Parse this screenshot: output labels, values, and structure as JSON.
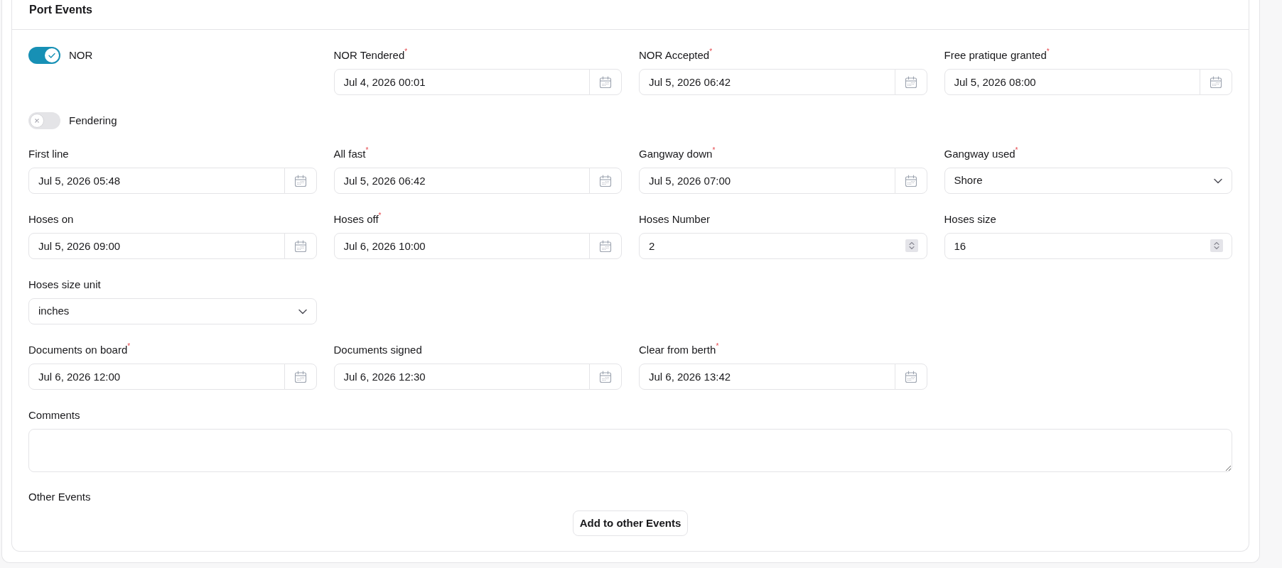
{
  "section": {
    "title": "Port Events"
  },
  "rows": [
    {
      "fields": [
        {
          "kind": "toggle",
          "label": "NOR",
          "on": true
        },
        {
          "kind": "datetime",
          "label": "NOR Tendered$^{*}$",
          "value": "Jul 4, 2026 00:01"
        },
        {
          "kind": "datetime",
          "label": "NOR Accepted$^{*}$",
          "value": "Jul 5, 2026 06:42"
        },
        {
          "kind": "datetime",
          "label": "Free pratique granted$^{*}$",
          "value": "Jul 5, 2026 08:00"
        }
      ]
    },
    {
      "fields": [
        {
          "kind": "toggle",
          "label": "Fendering",
          "on": false
        }
      ]
    },
    {
      "fields": [
        {
          "kind": "datetime",
          "label": "First line",
          "value": "Jul 5, 2026 05:48"
        },
        {
          "kind": "datetime",
          "label": "All fast$^{*}$",
          "value": "Jul 5, 2026 06:42"
        },
        {
          "kind": "datetime",
          "label": "Gangway down$^{*}$",
          "value": "Jul 5, 2026 07:00"
        },
        {
          "kind": "select",
          "label": "Gangway used$^{*}$",
          "value": "Shore"
        }
      ]
    },
    {
      "fields": [
        {
          "kind": "datetime",
          "label": "Hoses on",
          "value": "Jul 5, 2026 09:00"
        },
        {
          "kind": "datetime",
          "label": "Hoses off$^{*}$",
          "value": "Jul 6, 2026 10:00"
        },
        {
          "kind": "number",
          "label": "Hoses Number",
          "value": "2"
        },
        {
          "kind": "number",
          "label": "Hoses size",
          "value": "16"
        }
      ]
    },
    {
      "fields": [
        {
          "kind": "select",
          "label": "Hoses size unit",
          "value": "inches"
        }
      ]
    },
    {
      "fields": [
        {
          "kind": "datetime",
          "label": "Documents on board$^{*}$",
          "value": "Jul 6, 2026 12:00"
        },
        {
          "kind": "datetime",
          "label": "Documents signed",
          "value": "Jul 6, 2026 12:30"
        },
        {
          "kind": "datetime",
          "label": "Clear from berth$^{*}$",
          "value": "Jul 6, 2026 13:42"
        }
      ]
    },
    {
      "fields": [
        {
          "kind": "textarea",
          "label": "Comments"
        }
      ]
    }
  ],
  "other_events": {
    "label": "Other Events",
    "button": "Add to other Events"
  }
}
